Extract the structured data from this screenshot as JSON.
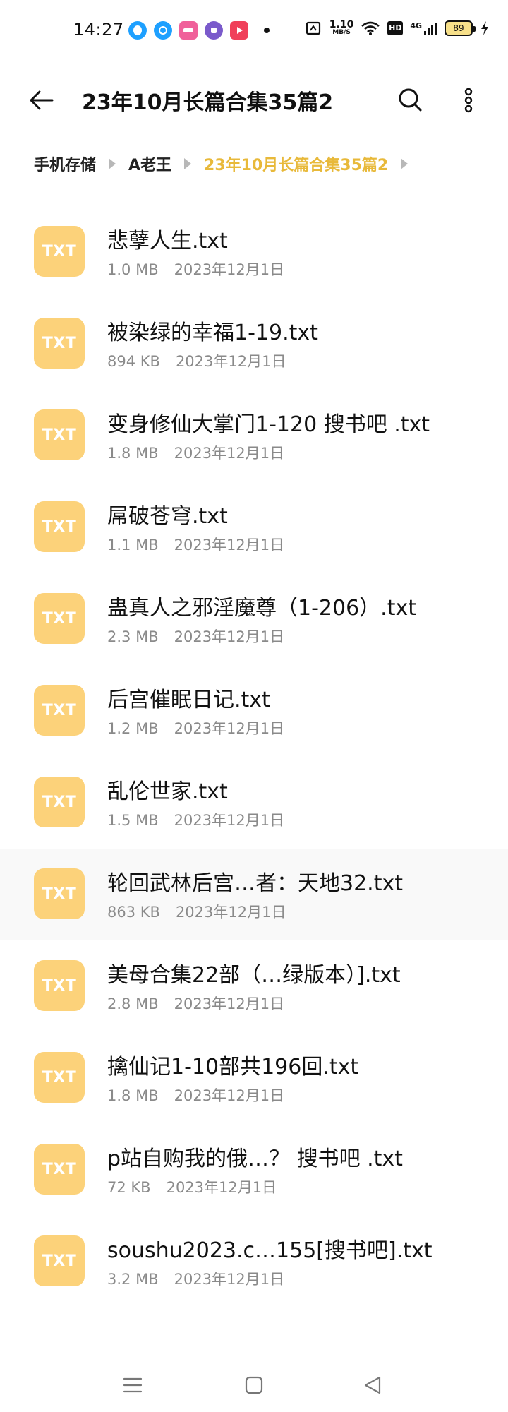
{
  "status_bar": {
    "time": "14:27",
    "net_speed_value": "1.10",
    "net_speed_unit": "MB/S",
    "network_type": "4G",
    "hd_label": "HD",
    "battery_level": "89",
    "app_icons": [
      "qq-icon",
      "qq-bell-icon",
      "pink-app-icon",
      "purple-app-icon",
      "red-play-icon"
    ],
    "app_icon_colors": [
      "#1ea0ff",
      "#1ea0ff",
      "#f0609a",
      "#7a5acb",
      "#f0405a"
    ]
  },
  "header": {
    "title": "23年10月长篇合集35篇2"
  },
  "breadcrumb": {
    "items": [
      "手机存储",
      "A老王",
      "23年10月长篇合集35篇2"
    ]
  },
  "files": [
    {
      "icon_label": "TXT",
      "name": "悲孽人生.txt",
      "size": "1.0 MB",
      "date": "2023年12月1日"
    },
    {
      "icon_label": "TXT",
      "name": "被染绿的幸福1-19.txt",
      "size": "894 KB",
      "date": "2023年12月1日"
    },
    {
      "icon_label": "TXT",
      "name": "变身修仙大掌门1-120 搜书吧 .txt",
      "size": "1.8 MB",
      "date": "2023年12月1日"
    },
    {
      "icon_label": "TXT",
      "name": "屌破苍穹.txt",
      "size": "1.1 MB",
      "date": "2023年12月1日"
    },
    {
      "icon_label": "TXT",
      "name": "蛊真人之邪淫魔尊（1-206）.txt",
      "size": "2.3 MB",
      "date": "2023年12月1日"
    },
    {
      "icon_label": "TXT",
      "name": "后宫催眠日记.txt",
      "size": "1.2 MB",
      "date": "2023年12月1日"
    },
    {
      "icon_label": "TXT",
      "name": "乱伦世家.txt",
      "size": "1.5 MB",
      "date": "2023年12月1日"
    },
    {
      "icon_label": "TXT",
      "name": "轮回武林后宫…者：天地32.txt",
      "size": "863 KB",
      "date": "2023年12月1日"
    },
    {
      "icon_label": "TXT",
      "name": "美母合集22部（…绿版本）].txt",
      "size": "2.8 MB",
      "date": "2023年12月1日"
    },
    {
      "icon_label": "TXT",
      "name": "擒仙记1-10部共196回.txt",
      "size": "1.8 MB",
      "date": "2023年12月1日"
    },
    {
      "icon_label": "TXT",
      "name": "p站自购我的俄…？ 搜书吧 .txt",
      "size": "72 KB",
      "date": "2023年12月1日"
    },
    {
      "icon_label": "TXT",
      "name": "soushu2023.c…155[搜书吧].txt",
      "size": "3.2 MB",
      "date": "2023年12月1日"
    }
  ],
  "colors": {
    "accent": "#e8b93a",
    "file_icon_bg": "#fcd27a",
    "meta_text": "#8a8a8a"
  }
}
